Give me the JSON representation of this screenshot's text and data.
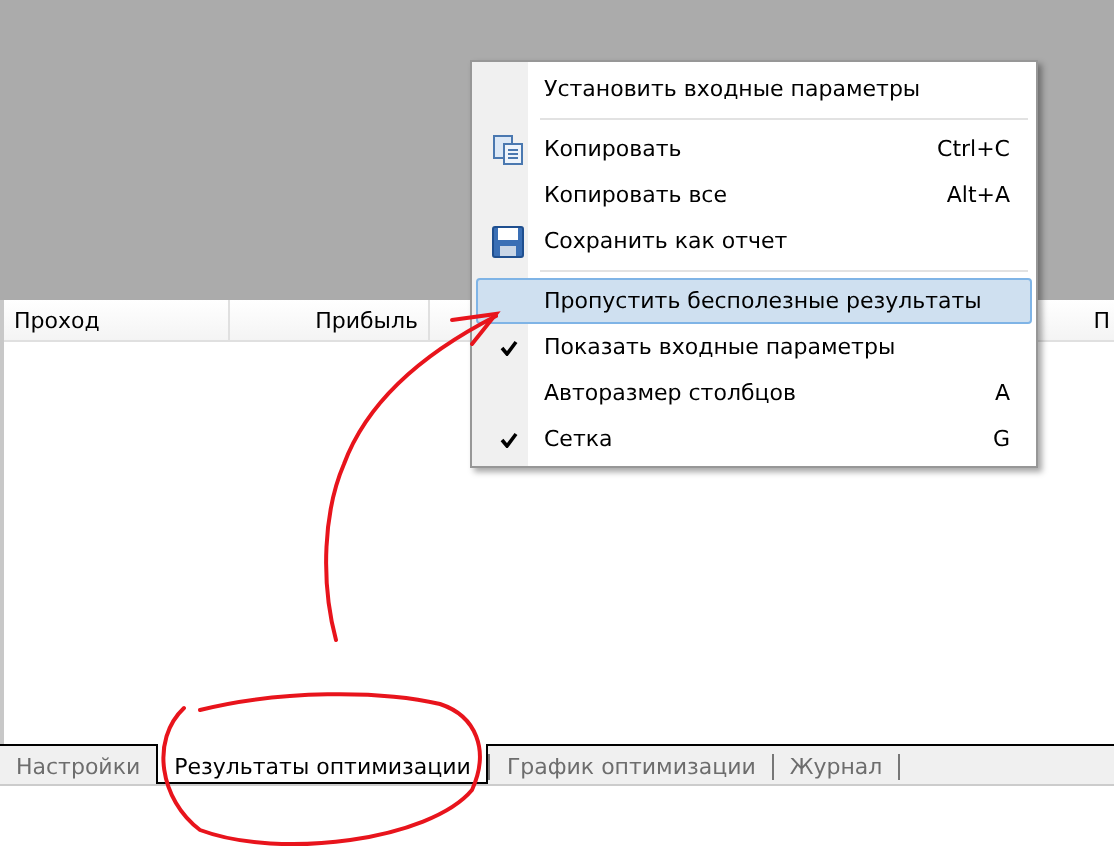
{
  "table": {
    "columns": [
      {
        "label": "Проход"
      },
      {
        "label": "Прибыль"
      },
      {
        "label": "П"
      }
    ]
  },
  "context_menu": {
    "items": [
      {
        "kind": "plain",
        "label": "Установить входные параметры",
        "checked": false,
        "selected": false
      },
      {
        "kind": "separator"
      },
      {
        "kind": "copy",
        "label": "Копировать",
        "shortcut": "Ctrl+C",
        "checked": false,
        "selected": false
      },
      {
        "kind": "plain",
        "label": "Копировать все",
        "shortcut": "Alt+A",
        "checked": false,
        "selected": false
      },
      {
        "kind": "save",
        "label": "Сохранить как отчет",
        "checked": false,
        "selected": false
      },
      {
        "kind": "separator"
      },
      {
        "kind": "plain",
        "label": "Пропустить бесполезные результаты",
        "checked": false,
        "selected": true
      },
      {
        "kind": "plain",
        "label": "Показать входные параметры",
        "checked": true,
        "selected": false
      },
      {
        "kind": "plain",
        "label": "Авторазмер столбцов",
        "shortcut": "A",
        "checked": false,
        "selected": false
      },
      {
        "kind": "plain",
        "label": "Сетка",
        "shortcut": "G",
        "checked": true,
        "selected": false
      }
    ]
  },
  "tabs": [
    {
      "label": "Настройки",
      "selected": false
    },
    {
      "label": "Результаты оптимизации",
      "selected": true
    },
    {
      "label": "График оптимизации",
      "selected": false
    },
    {
      "label": "Журнал",
      "selected": false
    }
  ]
}
